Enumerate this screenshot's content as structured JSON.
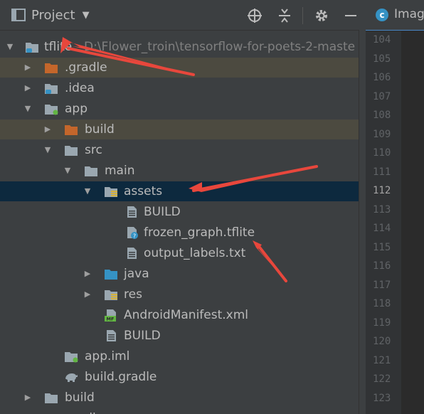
{
  "header": {
    "title": "Project",
    "icons": [
      "project-window-icon",
      "target-icon",
      "collapse-icon",
      "gear-icon",
      "minimize-icon"
    ]
  },
  "tree": {
    "root": {
      "name": "tflite",
      "path": "D:\\Flower_troin\\tensorflow-for-poets-2-maste"
    },
    "items": [
      {
        "label": ".gradle"
      },
      {
        "label": ".idea"
      },
      {
        "label": "app"
      },
      {
        "label": "build"
      },
      {
        "label": "src"
      },
      {
        "label": "main"
      },
      {
        "label": "assets"
      },
      {
        "label": "BUILD"
      },
      {
        "label": "frozen_graph.tflite"
      },
      {
        "label": "output_labels.txt"
      },
      {
        "label": "java"
      },
      {
        "label": "res"
      },
      {
        "label": "AndroidManifest.xml"
      },
      {
        "label": "BUILD"
      },
      {
        "label": "app.iml"
      },
      {
        "label": "build.gradle"
      },
      {
        "label": "build"
      },
      {
        "label": "gradle"
      }
    ]
  },
  "editor": {
    "tab_label": "Imag",
    "line_numbers": [
      "104",
      "105",
      "106",
      "107",
      "108",
      "109",
      "110",
      "111",
      "112",
      "113",
      "114",
      "115",
      "116",
      "117",
      "118",
      "119",
      "120",
      "121",
      "122",
      "123"
    ],
    "current_line": "112"
  },
  "colors": {
    "background": "#3c3f41",
    "selection": "#0d293e",
    "excluded_highlight": "#4c4a40",
    "annotation_arrow": "#e8473c",
    "folder_blue": "#3592c4",
    "folder_orange": "#c4662b",
    "folder_gray": "#9aa7b0"
  }
}
